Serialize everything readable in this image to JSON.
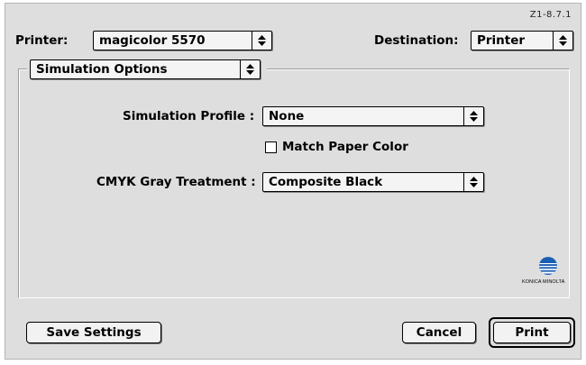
{
  "version": "Z1-8.7.1",
  "printer": {
    "label": "Printer:",
    "value": "magicolor 5570"
  },
  "destination": {
    "label": "Destination:",
    "value": "Printer"
  },
  "panel_select": {
    "value": "Simulation Options"
  },
  "simulation_profile": {
    "label": "Simulation Profile :",
    "value": "None"
  },
  "match_paper_color": {
    "label": "Match Paper Color",
    "checked": false
  },
  "cmyk_gray": {
    "label": "CMYK Gray Treatment :",
    "value": "Composite Black"
  },
  "logo": {
    "text": "KONICA MINOLTA",
    "color": "#1a5fb4"
  },
  "buttons": {
    "save": "Save Settings",
    "cancel": "Cancel",
    "print": "Print"
  }
}
